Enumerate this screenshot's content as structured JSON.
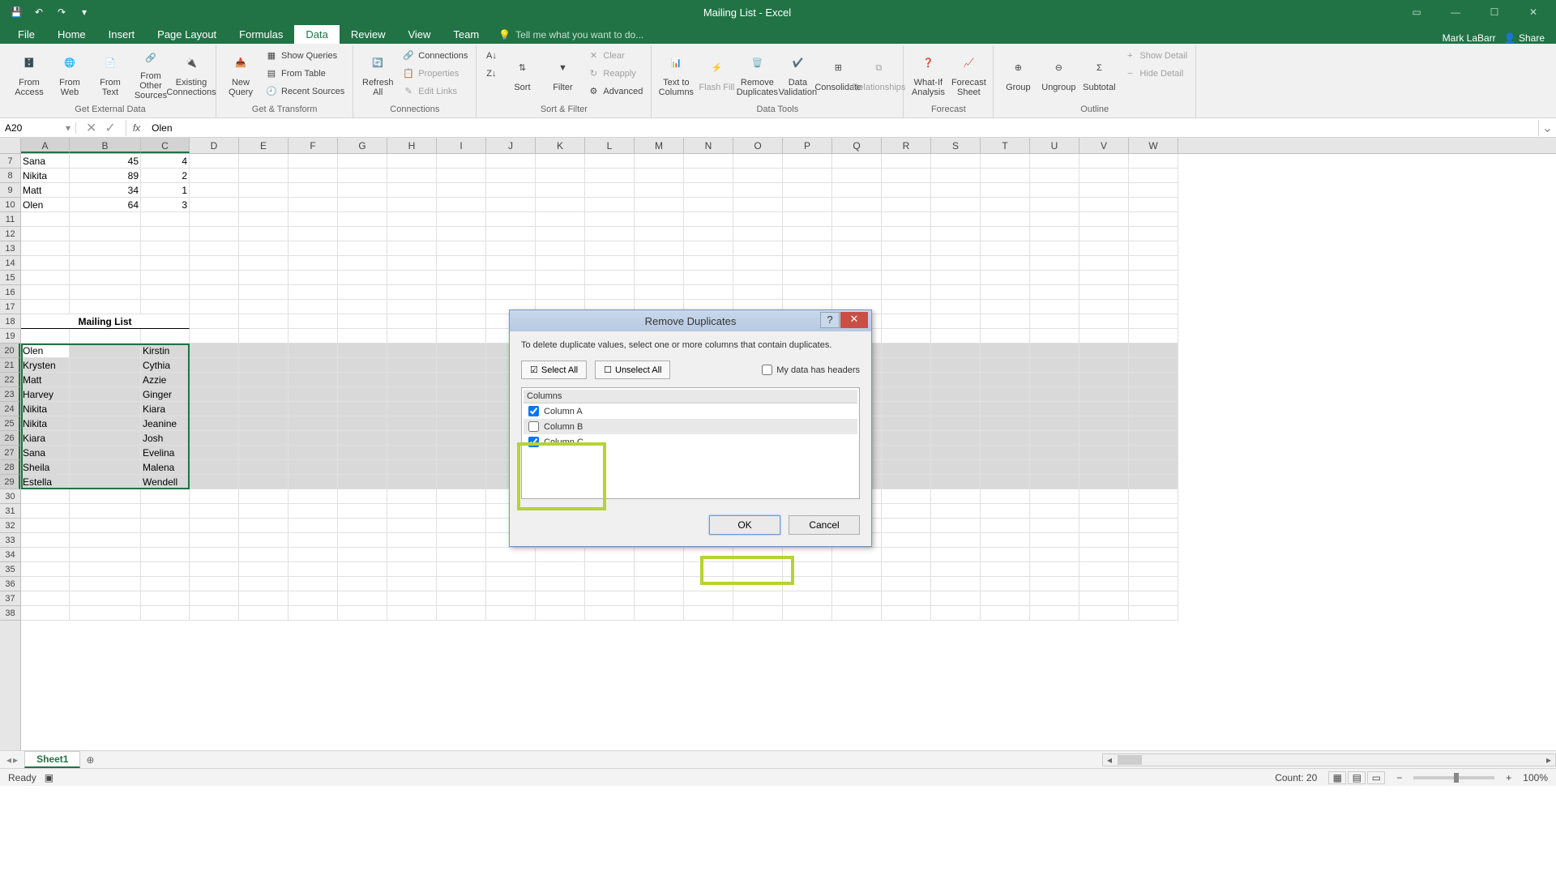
{
  "app": {
    "title": "Mailing List - Excel",
    "user": "Mark LaBarr",
    "share": "Share"
  },
  "tabs": [
    "File",
    "Home",
    "Insert",
    "Page Layout",
    "Formulas",
    "Data",
    "Review",
    "View",
    "Team"
  ],
  "active_tab": "Data",
  "tellme": "Tell me what you want to do...",
  "ribbon": {
    "get_external": {
      "label": "Get External Data",
      "access": "From Access",
      "web": "From Web",
      "text": "From Text",
      "other": "From Other Sources",
      "existing": "Existing Connections"
    },
    "get_transform": {
      "label": "Get & Transform",
      "newquery": "New Query",
      "show": "Show Queries",
      "table": "From Table",
      "recent": "Recent Sources"
    },
    "connections": {
      "label": "Connections",
      "refresh": "Refresh All",
      "conn": "Connections",
      "prop": "Properties",
      "edit": "Edit Links"
    },
    "sortfilter": {
      "label": "Sort & Filter",
      "sort": "Sort",
      "filter": "Filter",
      "clear": "Clear",
      "reapply": "Reapply",
      "advanced": "Advanced"
    },
    "datatools": {
      "label": "Data Tools",
      "t2c": "Text to Columns",
      "flash": "Flash Fill",
      "remdup": "Remove Duplicates",
      "valid": "Data Validation",
      "consol": "Consolidate",
      "rel": "Relationships"
    },
    "forecast": {
      "label": "Forecast",
      "whatif": "What-If Analysis",
      "sheet": "Forecast Sheet"
    },
    "outline": {
      "label": "Outline",
      "group": "Group",
      "ungroup": "Ungroup",
      "subtotal": "Subtotal",
      "showdet": "Show Detail",
      "hidedet": "Hide Detail"
    }
  },
  "namebox": "A20",
  "formula": "Olen",
  "columns": [
    "A",
    "B",
    "C",
    "D",
    "E",
    "F",
    "G",
    "H",
    "I",
    "J",
    "K",
    "L",
    "M",
    "N",
    "O",
    "P",
    "Q",
    "R",
    "S",
    "T",
    "U",
    "V",
    "W"
  ],
  "rows_visible": [
    7,
    8,
    9,
    10,
    11,
    12,
    13,
    14,
    15,
    16,
    17,
    18,
    19,
    20,
    21,
    22,
    23,
    24,
    25,
    26,
    27,
    28,
    29,
    30,
    31,
    32,
    33,
    34,
    35,
    36,
    37,
    38
  ],
  "cells": {
    "top": [
      {
        "r": 7,
        "a": "Sana",
        "b": "45",
        "c": "4"
      },
      {
        "r": 8,
        "a": "Nikita",
        "b": "89",
        "c": "2"
      },
      {
        "r": 9,
        "a": "Matt",
        "b": "34",
        "c": "1"
      },
      {
        "r": 10,
        "a": "Olen",
        "b": "64",
        "c": "3"
      }
    ],
    "heading_row": 18,
    "heading": "Mailing List",
    "list": [
      {
        "r": 20,
        "a": "Olen",
        "c": "Kirstin"
      },
      {
        "r": 21,
        "a": "Krysten",
        "c": "Cythia"
      },
      {
        "r": 22,
        "a": "Matt",
        "c": "Azzie"
      },
      {
        "r": 23,
        "a": "Harvey",
        "c": "Ginger"
      },
      {
        "r": 24,
        "a": "Nikita",
        "c": "Kiara"
      },
      {
        "r": 25,
        "a": "Nikita",
        "c": "Jeanine"
      },
      {
        "r": 26,
        "a": "Kiara",
        "c": "Josh"
      },
      {
        "r": 27,
        "a": "Sana",
        "c": "Evelina"
      },
      {
        "r": 28,
        "a": "Sheila",
        "c": "Malena"
      },
      {
        "r": 29,
        "a": "Estella",
        "c": "Wendell"
      }
    ]
  },
  "dialog": {
    "title": "Remove Duplicates",
    "msg": "To delete duplicate values, select one or more columns that contain duplicates.",
    "select_all": "Select All",
    "unselect_all": "Unselect All",
    "headers": "My data has headers",
    "headers_checked": false,
    "columns_hdr": "Columns",
    "items": [
      {
        "label": "Column A",
        "checked": true
      },
      {
        "label": "Column B",
        "checked": false
      },
      {
        "label": "Column C",
        "checked": true
      }
    ],
    "ok": "OK",
    "cancel": "Cancel"
  },
  "sheet": {
    "name": "Sheet1"
  },
  "status": {
    "ready": "Ready",
    "count": "Count: 20",
    "zoom": "100%"
  }
}
